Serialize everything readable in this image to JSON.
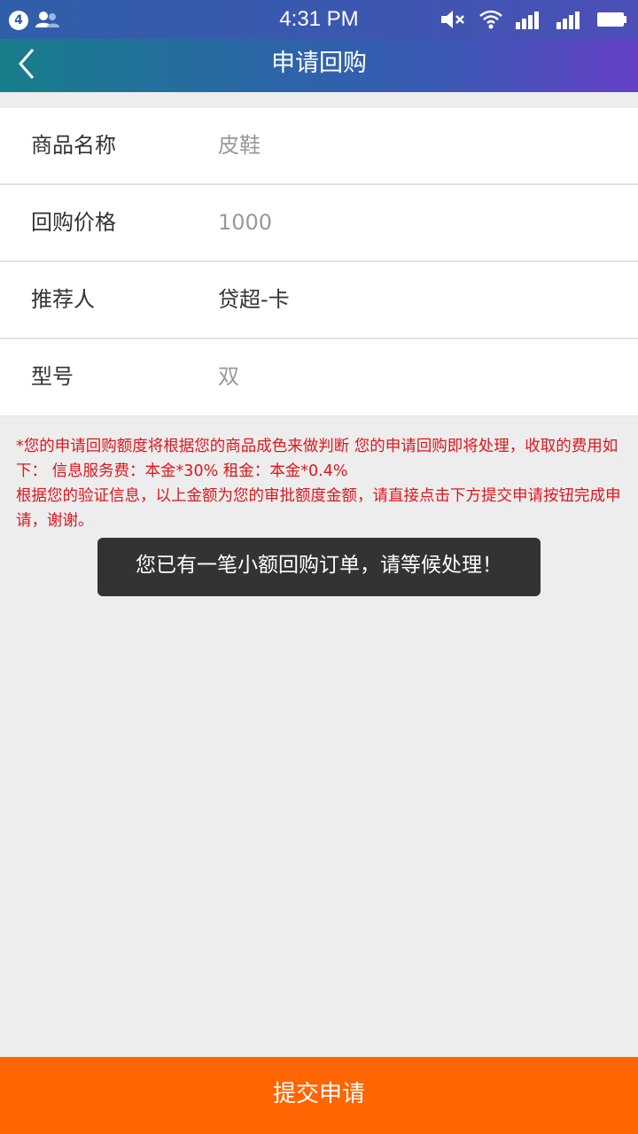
{
  "status_bar": {
    "notification_count": "4",
    "time": "4:31 PM",
    "icons": [
      "people-icon",
      "mute-icon",
      "wifi-icon",
      "signal-icon",
      "signal-icon",
      "battery-icon"
    ]
  },
  "header": {
    "title": "申请回购",
    "back_icon": "chevron-left-icon"
  },
  "form": {
    "rows": [
      {
        "label": "商品名称",
        "value": "皮鞋"
      },
      {
        "label": "回购价格",
        "value": "1000"
      },
      {
        "label": "推荐人",
        "value": "贷超-卡"
      },
      {
        "label": "型号",
        "value": "双"
      }
    ]
  },
  "notice": {
    "line1": "*您的申请回购额度将根据您的商品成色来做判断 您的申请回购即将处理，收取的费用如下：  信息服务费：本金*30% 租金：本金*0.4%",
    "line2": "根据您的验证信息，以上金额为您的审批额度金额，请直接点击下方提交申请按钮完成申请，谢谢。"
  },
  "toast": {
    "message": "您已有一笔小额回购订单，请等候处理！"
  },
  "footer": {
    "submit_label": "提交申请"
  },
  "colors": {
    "accent": "#ff6500",
    "notice_text": "#e0161c",
    "header_gradient_start": "#177e8a",
    "header_gradient_end": "#6540c6"
  }
}
